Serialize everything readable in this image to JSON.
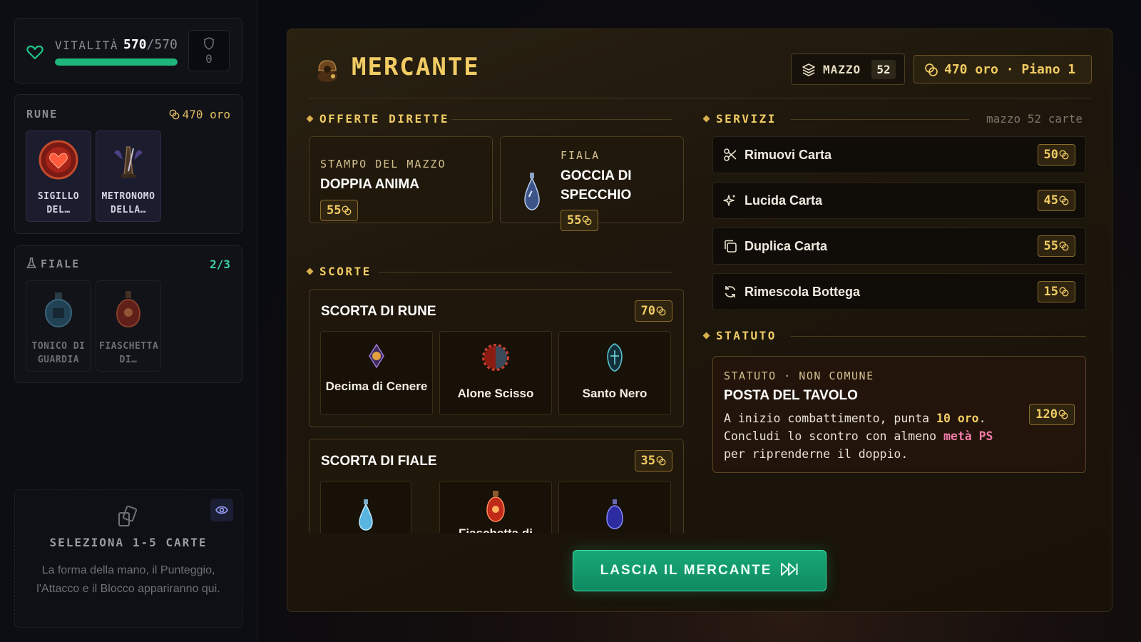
{
  "sidebar": {
    "vitality": {
      "label": "VITALITÀ",
      "current": "570",
      "max": "570",
      "fill_fraction": 1.0,
      "shield": "0"
    },
    "rune": {
      "label": "RUNE",
      "gold": "470 oro",
      "slots": [
        {
          "name": "SIGILLO DEL…"
        },
        {
          "name": "METRONOMO DELLA…"
        }
      ]
    },
    "fiale": {
      "label": "FIALE",
      "count": "2/3",
      "slots": [
        {
          "name": "TONICO DI GUARDIA"
        },
        {
          "name": "FIASCHETTA DI…"
        }
      ]
    },
    "select": {
      "title": "SELEZIONA 1-5 CARTE",
      "desc": "La forma della mano, il Punteggio, l'Attacco e il Blocco appariranno qui."
    }
  },
  "shop": {
    "title": "MERCANTE",
    "deck": {
      "label": "MAZZO",
      "count": "52"
    },
    "gold_status": "470 oro · Piano 1",
    "offers": {
      "heading": "OFFERTE DIRETTE",
      "items": [
        {
          "kicker": "STAMPO DEL MAZZO",
          "title": "DOPPIA ANIMA",
          "price": "55"
        },
        {
          "kicker": "FIALA",
          "title": "GOCCIA DI SPECCHIO",
          "price": "55"
        }
      ]
    },
    "stock": {
      "heading": "SCORTE",
      "runes": {
        "title": "SCORTA DI RUNE",
        "price": "70",
        "items": [
          {
            "name": "Decima di Cenere"
          },
          {
            "name": "Alone Scisso"
          },
          {
            "name": "Santo Nero"
          }
        ]
      },
      "vials": {
        "title": "SCORTA DI FIALE",
        "price": "35",
        "items": [
          {
            "name": ""
          },
          {
            "name": "Fiaschetta di"
          },
          {
            "name": ""
          }
        ]
      }
    },
    "services": {
      "heading": "SERVIZI",
      "note": "mazzo 52 carte",
      "items": [
        {
          "label": "Rimuovi Carta",
          "price": "50",
          "icon": "scissors-icon"
        },
        {
          "label": "Lucida Carta",
          "price": "45",
          "icon": "sparkle-icon"
        },
        {
          "label": "Duplica Carta",
          "price": "55",
          "icon": "copy-icon"
        },
        {
          "label": "Rimescola Bottega",
          "price": "15",
          "icon": "refresh-icon"
        }
      ]
    },
    "statute": {
      "heading": "STATUTO",
      "kicker": "STATUTO · NON COMUNE",
      "title": "POSTA DEL TAVOLO",
      "desc_a": "A inizio combattimento, punta ",
      "desc_gold": "10 oro",
      "desc_b": ". Concludi lo scontro con almeno ",
      "desc_pink": "metà PS",
      "desc_c": " per riprenderne il doppio.",
      "price": "120"
    },
    "leave_label": "LASCIA IL MERCANTE"
  },
  "colors": {
    "accent_gold": "#f1cc64",
    "health_green": "#1db57b",
    "leave_green": "#17a877",
    "highlight_pink": "#f07ca8"
  }
}
